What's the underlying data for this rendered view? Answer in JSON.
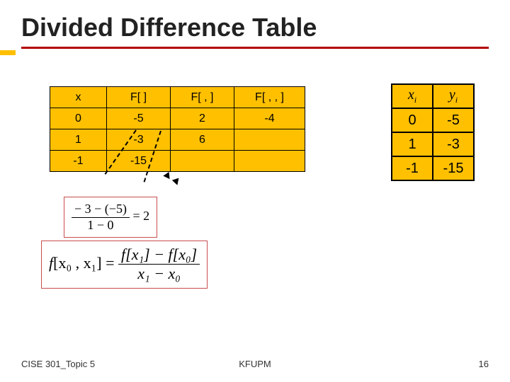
{
  "title": "Divided Difference Table",
  "left_table": {
    "headers": [
      "x",
      "F[ ]",
      "F[ , ]",
      "F[ , , ]"
    ],
    "rows": [
      {
        "x": "0",
        "f0": "-5",
        "f1": "2",
        "f2": "-4"
      },
      {
        "x": "1",
        "f0": "-3",
        "f1": "6",
        "f2": ""
      },
      {
        "x": "-1",
        "f0": "-15",
        "f1": "",
        "f2": ""
      }
    ]
  },
  "right_table": {
    "headers": {
      "x": "x",
      "xi": "i",
      "y": "y",
      "yi": "i"
    },
    "rows": [
      {
        "x": "0",
        "y": "-5"
      },
      {
        "x": "1",
        "y": "-3"
      },
      {
        "x": "-1",
        "y": "-15"
      }
    ]
  },
  "formula1": {
    "num": "− 3 − (−5)",
    "den": "1 − 0",
    "eq": "= 2"
  },
  "formula2": {
    "lhs_prefix": "f",
    "lhs_args": "[x₀ , x₁]",
    "num": "f[x₁] − f[x₀]",
    "den": "x₁ − x₀"
  },
  "footer": {
    "left": "CISE 301_Topic 5",
    "center": "KFUPM",
    "right": "16"
  }
}
